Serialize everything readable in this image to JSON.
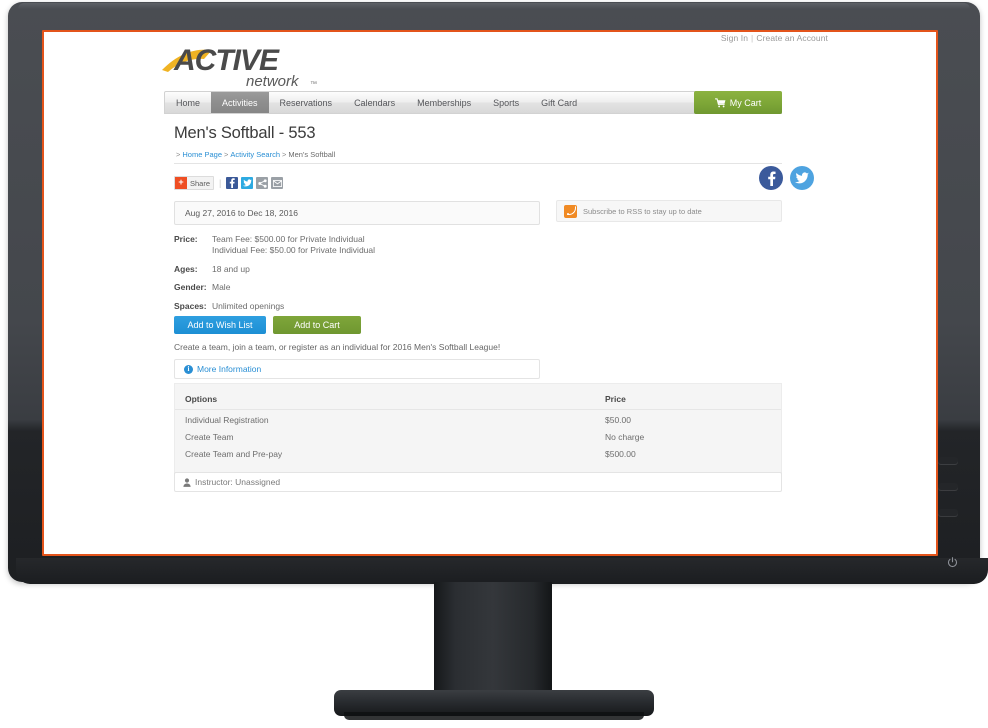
{
  "topbar": {
    "sign_in": "Sign In",
    "separator": "|",
    "create_account": "Create an Account"
  },
  "logo": {
    "primary_text": "ACTIVE",
    "secondary_text": "network",
    "trademark": "™",
    "swoosh_color": "#f0b323",
    "wordmark_color": "#4a4a4a"
  },
  "nav": {
    "items": [
      {
        "label": "Home",
        "active": false
      },
      {
        "label": "Activities",
        "active": true
      },
      {
        "label": "Reservations",
        "active": false
      },
      {
        "label": "Calendars",
        "active": false
      },
      {
        "label": "Memberships",
        "active": false
      },
      {
        "label": "Sports",
        "active": false
      },
      {
        "label": "Gift Card",
        "active": false
      }
    ],
    "cart_label": "My Cart",
    "cart_color": "#7da637"
  },
  "page": {
    "title": "Men's Softball - 553",
    "breadcrumb": {
      "prefix": ">",
      "items": [
        "Home Page",
        "Activity Search"
      ],
      "current": "Men's Softball",
      "chevron": ">"
    }
  },
  "share": {
    "addthis_plus": "+",
    "addthis_label": "Share",
    "separator": "|",
    "buttons": [
      "facebook-share",
      "twitter-share",
      "generic-share",
      "email-share"
    ]
  },
  "social": {
    "facebook_label": "f",
    "buttons": [
      "facebook-circle",
      "twitter-circle"
    ]
  },
  "date": {
    "range": "Aug 27, 2016 to Dec 18, 2016"
  },
  "rss": {
    "label": "Subscribe to RSS to stay up to date",
    "color": "#f08a24"
  },
  "details": [
    {
      "label": "Price:",
      "lines": [
        "Team Fee: $500.00 for Private Individual",
        "Individual Fee: $50.00 for Private Individual"
      ]
    },
    {
      "label": "Ages:",
      "lines": [
        "18 and up"
      ]
    },
    {
      "label": "Gender:",
      "lines": [
        "Male"
      ]
    },
    {
      "label": "Spaces:",
      "lines": [
        "Unlimited openings"
      ]
    }
  ],
  "actions": {
    "wish_list_label": "Add to Wish List",
    "wish_list_color": "#1d8fd4",
    "cart_label": "Add to Cart",
    "cart_color": "#6f9730"
  },
  "description": "Create a team, join a team, or register as an individual for 2016 Men's Softball League!",
  "more_information": {
    "icon_char": "i",
    "label": "More Information",
    "color": "#2a8fd4"
  },
  "options_table": {
    "columns": [
      "Options",
      "Price"
    ],
    "rows": [
      {
        "option": "Individual Registration",
        "price": "$50.00"
      },
      {
        "option": "Create Team",
        "price": "No charge"
      },
      {
        "option": "Create Team and Pre-pay",
        "price": "$500.00"
      }
    ]
  },
  "instructor": {
    "label": "Instructor: Unassigned"
  },
  "monitor": {
    "power_glyph": "⏻",
    "screen_border_color": "#e3541b"
  }
}
